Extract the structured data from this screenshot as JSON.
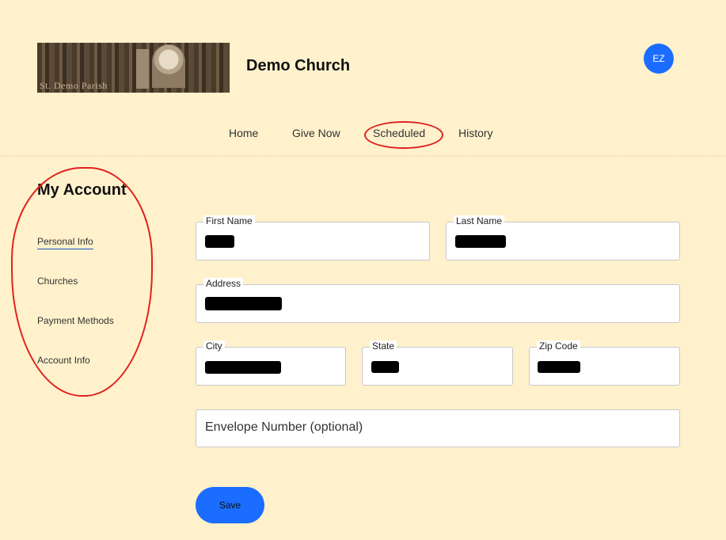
{
  "header": {
    "logo_text": "St. Demo Parish",
    "church_name": "Demo Church",
    "avatar_initials": "EZ"
  },
  "nav": {
    "items": [
      {
        "label": "Home"
      },
      {
        "label": "Give Now"
      },
      {
        "label": "Scheduled"
      },
      {
        "label": "History"
      }
    ]
  },
  "sidebar": {
    "title": "My Account",
    "items": [
      {
        "label": "Personal Info",
        "active": true
      },
      {
        "label": "Churches"
      },
      {
        "label": "Payment Methods"
      },
      {
        "label": "Account Info"
      }
    ]
  },
  "form": {
    "first_name_label": "First Name",
    "last_name_label": "Last Name",
    "address_label": "Address",
    "city_label": "City",
    "state_label": "State",
    "zip_label": "Zip Code",
    "envelope_placeholder": "Envelope Number  (optional)",
    "save_label": "Save"
  },
  "colors": {
    "background": "#fff1cc",
    "accent": "#1a6dff",
    "annotation": "#e0211f"
  }
}
